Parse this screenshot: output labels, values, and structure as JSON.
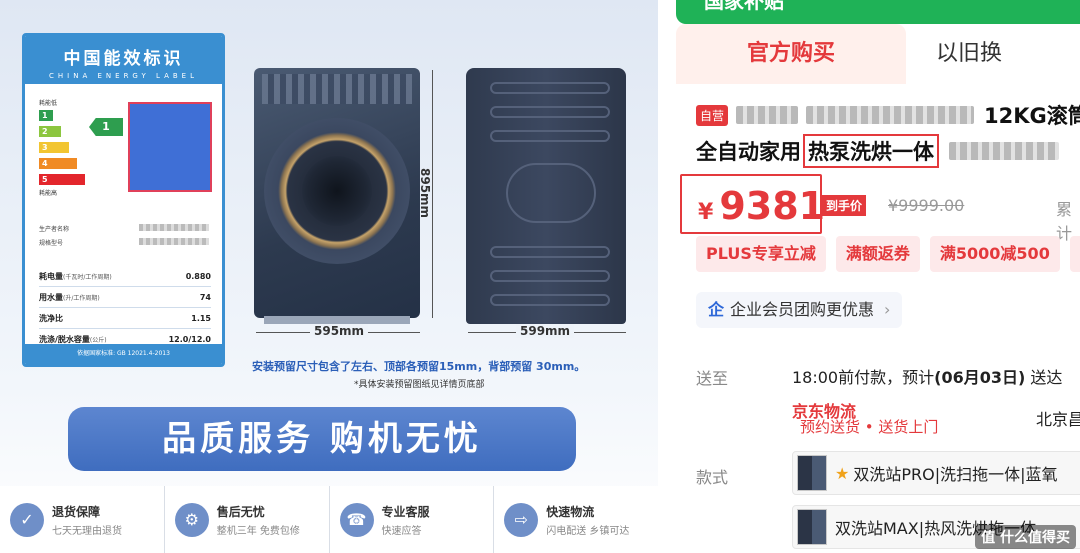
{
  "left": {
    "energy_label": {
      "title": "中国能效标识",
      "subtitle": "CHINA ENERGY LABEL",
      "grade_top": "耗能低",
      "grade_bottom": "耗能高",
      "grades": [
        "1",
        "2",
        "3",
        "4",
        "5"
      ],
      "current_grade": "1",
      "maker_label": "生产者名称",
      "model_label": "规格型号",
      "specs": [
        {
          "key": "耗电量",
          "sub": "(千瓦时/工作周期)",
          "value": "0.880"
        },
        {
          "key": "用水量",
          "sub": "(升/工作周期)",
          "value": "74"
        },
        {
          "key": "洗净比",
          "sub": "",
          "value": "1.15"
        },
        {
          "key": "洗涤/脱水容量",
          "sub": "(公斤)",
          "value": "12.0/12.0"
        }
      ],
      "footer": "依据国家标准: GB 12021.4-2013"
    },
    "dimensions": {
      "height": "895mm",
      "width": "595mm",
      "depth": "599mm"
    },
    "install_note": "安装预留尺寸包含了左右、顶部各预留15mm，背部预留 30mm。",
    "install_note2": "*具体安装预留图纸见详情页底部",
    "banner": "品质服务 购机无忧",
    "services": [
      {
        "icon": "shield-icon",
        "glyph": "✓",
        "title": "退货保障",
        "sub": "七天无理由退货"
      },
      {
        "icon": "wrench-icon",
        "glyph": "⚙",
        "title": "售后无忧",
        "sub": "整机三年 免费包修"
      },
      {
        "icon": "headset-icon",
        "glyph": "☎",
        "title": "专业客服",
        "sub": "快速应答"
      },
      {
        "icon": "truck-icon",
        "glyph": "⇨",
        "title": "快速物流",
        "sub": "闪电配送 乡镇可达"
      }
    ]
  },
  "right": {
    "top_strip": "国家补贴",
    "tabs": [
      {
        "label": "官方购买",
        "active": true
      },
      {
        "label": "以旧换",
        "active": false
      }
    ],
    "self_badge": "自营",
    "title_part1": "12KG滚筒",
    "title_part2": "全自动家用",
    "title_highlight": "热泵洗烘一体",
    "price": {
      "currency": "¥",
      "value": "9381",
      "tag": "到手价",
      "original": "¥9999.00",
      "accumulate": "累计"
    },
    "promos": [
      "PLUS专享立减",
      "满额返券",
      "满5000减500"
    ],
    "enterprise": {
      "icon": "企",
      "text": "企业会员团购更优惠",
      "arrow": "›"
    },
    "shipping": {
      "label": "送至",
      "text_pre": "18:00前付款，预计",
      "date": "(06月03日)",
      "text_post": " 送达",
      "logistics": "京东物流",
      "reserve": "预约送货 • 送货上门",
      "city": "北京昌"
    },
    "style": {
      "label": "款式",
      "options": [
        {
          "text": "双洗站PRO|洗扫拖一体|蓝氧",
          "starred": true
        },
        {
          "text": "双洗站MAX|热风洗烘拖一体",
          "starred": false
        }
      ]
    },
    "watermark": "值 什么值得买"
  },
  "colors": {
    "jd_red": "#e4393c",
    "label_blue": "#3a8fd1",
    "banner_blue": "#3f6dbf",
    "subsidy_green": "#1fb257"
  }
}
